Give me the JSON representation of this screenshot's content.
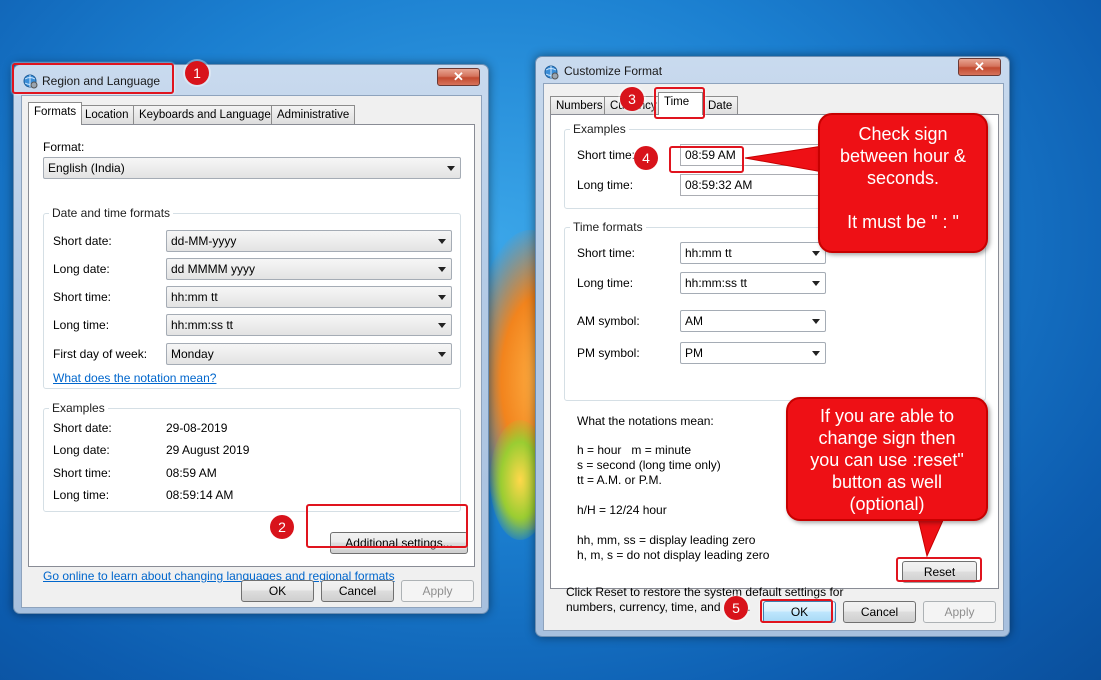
{
  "colors": {
    "accent_red": "#e0141e",
    "link": "#0066cc"
  },
  "region_window": {
    "title": "Region and Language",
    "icon": "globe-gear-icon",
    "close_label": "✕",
    "tabs": [
      "Formats",
      "Location",
      "Keyboards and Languages",
      "Administrative"
    ],
    "format_label": "Format:",
    "format_value": "English (India)",
    "date_time_group": "Date and time formats",
    "rows": [
      {
        "label": "Short date:",
        "value": "dd-MM-yyyy"
      },
      {
        "label": "Long date:",
        "value": "dd MMMM yyyy"
      },
      {
        "label": "Short time:",
        "value": "hh:mm tt"
      },
      {
        "label": "Long time:",
        "value": "hh:mm:ss tt"
      },
      {
        "label": "First day of week:",
        "value": "Monday"
      }
    ],
    "notation_link": "What does the notation mean?",
    "examples_group": "Examples",
    "examples": [
      {
        "label": "Short date:",
        "value": "29-08-2019"
      },
      {
        "label": "Long date:",
        "value": "29 August 2019"
      },
      {
        "label": "Short time:",
        "value": "08:59 AM"
      },
      {
        "label": "Long time:",
        "value": "08:59:14 AM"
      }
    ],
    "additional_settings": "Additional settings...",
    "online_link": "Go online to learn about changing languages and regional formats",
    "ok": "OK",
    "cancel": "Cancel",
    "apply": "Apply"
  },
  "customize_window": {
    "title": "Customize Format",
    "close_label": "✕",
    "tabs": [
      "Numbers",
      "Currency",
      "Time",
      "Date"
    ],
    "examples_group": "Examples",
    "short_time_label": "Short time:",
    "short_time_value": "08:59 AM",
    "long_time_label": "Long time:",
    "long_time_value": "08:59:32 AM",
    "time_formats_group": "Time formats",
    "formats": [
      {
        "label": "Short time:",
        "value": "hh:mm tt"
      },
      {
        "label": "Long time:",
        "value": "hh:mm:ss tt"
      },
      {
        "label": "AM symbol:",
        "value": "AM"
      },
      {
        "label": "PM symbol:",
        "value": "PM"
      }
    ],
    "notation_title": "What the notations mean:",
    "notation_lines": [
      "h = hour   m = minute",
      "s = second (long time only)",
      "tt = A.M. or P.M.",
      "",
      "h/H = 12/24 hour",
      "",
      "hh, mm, ss = display leading zero",
      "h, m, s = do not display leading zero"
    ],
    "reset_info": "Click Reset to restore the system default settings for\nnumbers, currency, time, and date.",
    "reset": "Reset",
    "ok": "OK",
    "cancel": "Cancel",
    "apply": "Apply"
  },
  "annotations": {
    "badges": [
      "1",
      "2",
      "3",
      "4",
      "5"
    ],
    "callout_check": "Check sign\nbetween hour &\nseconds.\n\nIt must be \" : \"",
    "callout_reset": "If you are able to\nchange sign then\nyou can use :reset\"\nbutton as well\n(optional)"
  }
}
